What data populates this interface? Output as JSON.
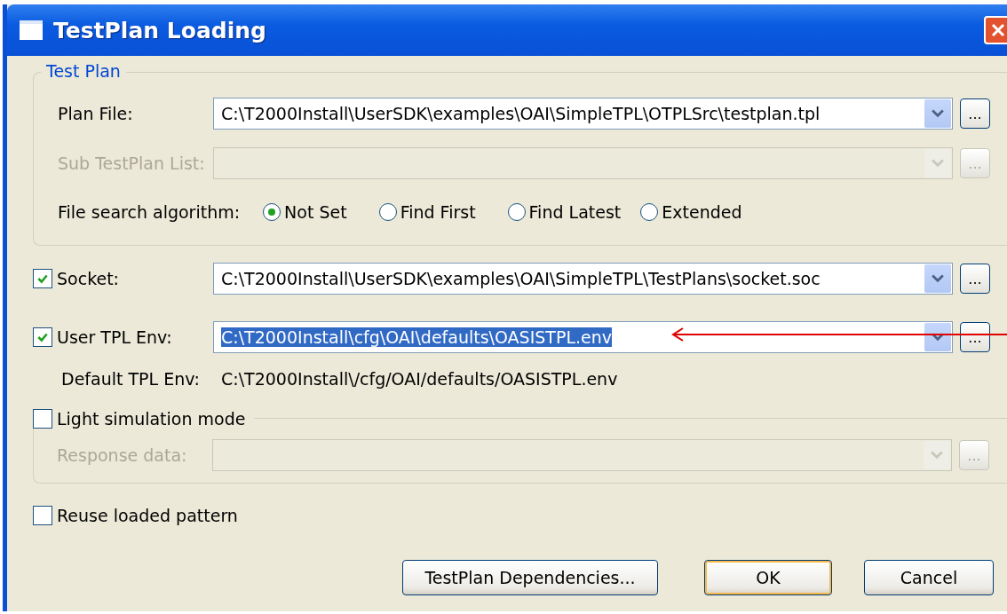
{
  "window": {
    "title": "TestPlan Loading"
  },
  "test_plan": {
    "legend": "Test Plan",
    "rows": [
      {
        "label": "Plan File:",
        "value": "C:\\T2000Install\\UserSDK\\examples\\OAI\\SimpleTPL\\OTPLSrc\\testplan.tpl",
        "disabled": false,
        "browse": "..."
      },
      {
        "label": "Sub TestPlan List:",
        "disabled": true,
        "browse": "..."
      }
    ],
    "search_label": "File search algorithm:",
    "search_options": [
      {
        "label": "Not Set",
        "selected": true
      },
      {
        "label": "Find First",
        "selected": false
      },
      {
        "label": "Find Latest",
        "selected": false
      },
      {
        "label": "Extended",
        "selected": false
      }
    ]
  },
  "options": [
    {
      "label": "Socket:",
      "checked": true,
      "value": "C:\\T2000Install\\UserSDK\\examples\\OAI\\SimpleTPL\\TestPlans\\socket.soc",
      "text_selected": false,
      "browse": "..."
    },
    {
      "label": "User TPL Env:",
      "checked": true,
      "value": "C:\\T2000Install\\cfg\\OAI\\defaults\\OASISTPL.env",
      "text_selected": true,
      "browse": "..."
    }
  ],
  "default_env": {
    "label": "Default TPL Env:",
    "value": "C:\\T2000Install\\/cfg/OAI/defaults/OASISTPL.env"
  },
  "light_simulation": {
    "label": "Light simulation mode",
    "checked": false,
    "row": {
      "label": "Response data:",
      "disabled": true,
      "browse": "..."
    }
  },
  "reuse_pattern": {
    "label": "Reuse loaded pattern",
    "checked": false
  },
  "buttons": [
    {
      "label": "TestPlan Dependencies...",
      "default": false
    },
    {
      "label": "OK",
      "default": true
    },
    {
      "label": "Cancel",
      "default": false
    }
  ]
}
